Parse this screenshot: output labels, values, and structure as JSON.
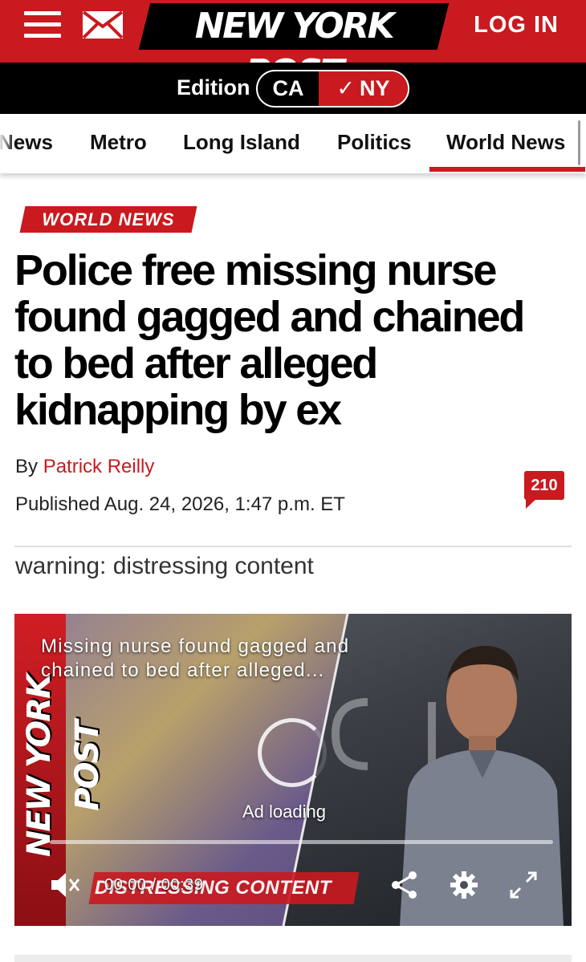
{
  "header": {
    "logo": "NEW YORK POST",
    "login_label": "LOG IN",
    "brand_color": "#c91a1f"
  },
  "edition": {
    "label": "Edition",
    "options": [
      "CA",
      "NY"
    ],
    "selected": "NY"
  },
  "nav": {
    "items": [
      "News",
      "Metro",
      "Long Island",
      "Politics",
      "World News"
    ],
    "active": "World News"
  },
  "article": {
    "kicker": "WORLD NEWS",
    "headline": "Police free missing nurse found gagged and chained to bed after alleged kidnapping by ex",
    "byline_prefix": "By",
    "author": "Patrick Reilly",
    "published": "Published Aug. 24, 2026, 1:47 p.m. ET",
    "comment_count": "210",
    "warning": "warning: distressing content"
  },
  "video": {
    "title": "Missing nurse found gagged and chained to bed after alleged...",
    "watermark": "NEW YORK POST",
    "status": "Ad loading",
    "time": "00:00 / 00:39",
    "overlay_label": "DISTRESSING CONTENT",
    "progress": 0
  }
}
